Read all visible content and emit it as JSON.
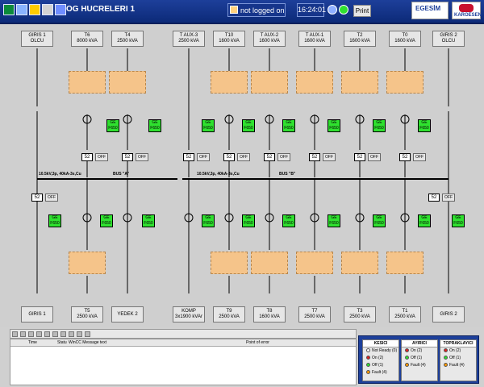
{
  "header": {
    "title": "OG HUCRELERI 1",
    "login_status": "not logged on",
    "time": "16:24:01",
    "print_label": "Print",
    "logo_text": "EGESİM",
    "company_text": "KAROESEN"
  },
  "top_labels": [
    {
      "l1": "GIRIS 1",
      "l2": "OLCU"
    },
    {
      "l1": "T6",
      "l2": "8000 kVA"
    },
    {
      "l1": "T4",
      "l2": "2500 kVA"
    },
    {
      "l1": "T AUX-3",
      "l2": "2500 kVA"
    },
    {
      "l1": "T10",
      "l2": "1600 kVA"
    },
    {
      "l1": "T AUX-2",
      "l2": "1600 kVA"
    },
    {
      "l1": "T AUX-1",
      "l2": "1600 kVA"
    },
    {
      "l1": "T2",
      "l2": "1600 kVA"
    },
    {
      "l1": "T0",
      "l2": "1600 kVA"
    },
    {
      "l1": "GIRIS 2",
      "l2": "OLCU"
    }
  ],
  "bottom_labels": [
    {
      "l1": "GIRIS 1",
      "l2": ""
    },
    {
      "l1": "T5",
      "l2": "2500 kVA"
    },
    {
      "l1": "YEDEK 2",
      "l2": ""
    },
    {
      "l1": "KOMP",
      "l2": "3x1900 kVAr"
    },
    {
      "l1": "T9",
      "l2": "2500 kVA"
    },
    {
      "l1": "T8",
      "l2": "1600 kVA"
    },
    {
      "l1": "T7",
      "l2": "2500 kVA"
    },
    {
      "l1": "T3",
      "l2": "2500 kVA"
    },
    {
      "l1": "T1",
      "l2": "2500 kVA"
    },
    {
      "l1": "GIRIS 2",
      "l2": ""
    }
  ],
  "bus": {
    "left": "10.5kV,3p, 40kA-3s,Cu",
    "bus_a": "BUS \"A\"",
    "right": "10.5kV,3p, 40kA-3s,Cu",
    "bus_b": "BUS \"B\""
  },
  "breaker_label": "52",
  "off_label": "OFF",
  "relay_label": "GE F650",
  "messages": {
    "col1": "Time",
    "col2": "Statu",
    "col3": "WinCC Message text",
    "col4": "Point of error"
  },
  "status_panel": {
    "kesici": "KESICI",
    "ayirici": "AYIRICI",
    "topraklayici": "TOPRAKLAYICI",
    "kesici_items": [
      "Not Ready (0)",
      "On (2)",
      "Off (1)",
      "Fault (4)"
    ],
    "ayirici_items": [
      "On (2)",
      "Off (1)",
      "Fault (4)"
    ],
    "topraklayici_items": [
      "On (2)",
      "Off (1)",
      "Fault (4)"
    ]
  }
}
